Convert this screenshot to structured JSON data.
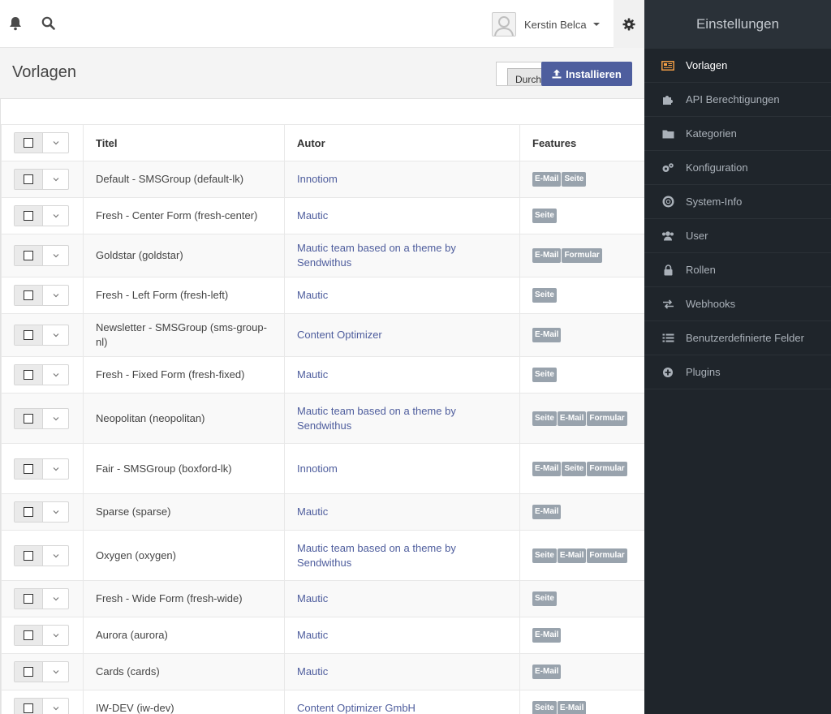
{
  "topbar": {
    "user_name": "Kerstin Belca"
  },
  "page": {
    "title": "Vorlagen",
    "browse_text": "Durchsuchen...",
    "install_label": "Installieren"
  },
  "table": {
    "headers": [
      "Titel",
      "Autor",
      "Features"
    ],
    "rows": [
      {
        "title": "Default - SMSGroup (default-lk)",
        "author": "Innotiom",
        "features": [
          "E-Mail",
          "Seite"
        ]
      },
      {
        "title": "Fresh - Center Form (fresh-center)",
        "author": "Mautic",
        "features": [
          "Seite"
        ]
      },
      {
        "title": "Goldstar (goldstar)",
        "author": "Mautic team based on a theme by Sendwithus",
        "features": [
          "E-Mail",
          "Formular"
        ]
      },
      {
        "title": "Fresh - Left Form (fresh-left)",
        "author": "Mautic",
        "features": [
          "Seite"
        ]
      },
      {
        "title": "Newsletter - SMSGroup (sms-group-nl)",
        "author": "Content Optimizer",
        "features": [
          "E-Mail"
        ]
      },
      {
        "title": "Fresh - Fixed Form (fresh-fixed)",
        "author": "Mautic",
        "features": [
          "Seite"
        ]
      },
      {
        "title": "Neopolitan (neopolitan)",
        "author": "Mautic team based on a theme by Sendwithus",
        "features": [
          "Seite",
          "E-Mail",
          "Formular"
        ]
      },
      {
        "title": "Fair - SMSGroup (boxford-lk)",
        "author": "Innotiom",
        "features": [
          "E-Mail",
          "Seite",
          "Formular"
        ]
      },
      {
        "title": "Sparse (sparse)",
        "author": "Mautic",
        "features": [
          "E-Mail"
        ]
      },
      {
        "title": "Oxygen (oxygen)",
        "author": "Mautic team based on a theme by Sendwithus",
        "features": [
          "Seite",
          "E-Mail",
          "Formular"
        ]
      },
      {
        "title": "Fresh - Wide Form (fresh-wide)",
        "author": "Mautic",
        "features": [
          "Seite"
        ]
      },
      {
        "title": "Aurora (aurora)",
        "author": "Mautic",
        "features": [
          "E-Mail"
        ]
      },
      {
        "title": "Cards (cards)",
        "author": "Mautic",
        "features": [
          "E-Mail"
        ]
      },
      {
        "title": "IW-DEV (iw-dev)",
        "author": "Content Optimizer GmbH",
        "features": [
          "Seite",
          "E-Mail"
        ]
      }
    ]
  },
  "sidebar": {
    "title": "Einstellungen",
    "items": [
      {
        "label": "Vorlagen",
        "icon": "newspaper-icon",
        "active": true
      },
      {
        "label": "API Berechtigungen",
        "icon": "puzzle-icon",
        "active": false
      },
      {
        "label": "Kategorien",
        "icon": "folder-icon",
        "active": false
      },
      {
        "label": "Konfiguration",
        "icon": "cogs-icon",
        "active": false
      },
      {
        "label": "System-Info",
        "icon": "life-ring-icon",
        "active": false
      },
      {
        "label": "User",
        "icon": "users-icon",
        "active": false
      },
      {
        "label": "Rollen",
        "icon": "lock-icon",
        "active": false
      },
      {
        "label": "Webhooks",
        "icon": "exchange-icon",
        "active": false
      },
      {
        "label": "Benutzerdefinierte Felder",
        "icon": "list-icon",
        "active": false
      },
      {
        "label": "Plugins",
        "icon": "plus-circle-icon",
        "active": false
      }
    ]
  },
  "colors": {
    "accent": "#4e5e9e",
    "active_icon": "#fda446",
    "sidebar_bg": "#1f252b",
    "badge_bg": "#99a3ad"
  }
}
